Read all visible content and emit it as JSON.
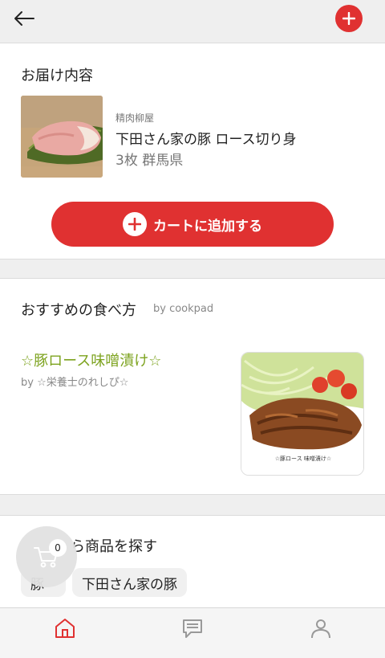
{
  "topbar": {
    "back_icon": "arrow-left-icon",
    "add_icon": "plus-circle-icon"
  },
  "delivery": {
    "title": "お届け内容",
    "shop": "精肉柳屋",
    "product_name": "下田さん家の豚 ロース切り身",
    "detail": "3枚 群馬県",
    "cart_button_label": "カートに追加する"
  },
  "recommend": {
    "title": "おすすめの食べ方",
    "by": "by cookpad",
    "recipe_title": "☆豚ロース味噌漬け☆",
    "recipe_author": "by ☆栄養士のれしぴ☆",
    "image_caption": "☆豚ロース 味噌漬け☆"
  },
  "search": {
    "title_visible": "ら商品を探す",
    "chips": [
      "豚",
      "下田さん家の豚"
    ]
  },
  "cart": {
    "count": "0"
  },
  "colors": {
    "accent": "#e03131",
    "recipe_green": "#7da31f"
  },
  "nav": {
    "items": [
      "home-icon",
      "chat-icon",
      "user-icon"
    ]
  }
}
